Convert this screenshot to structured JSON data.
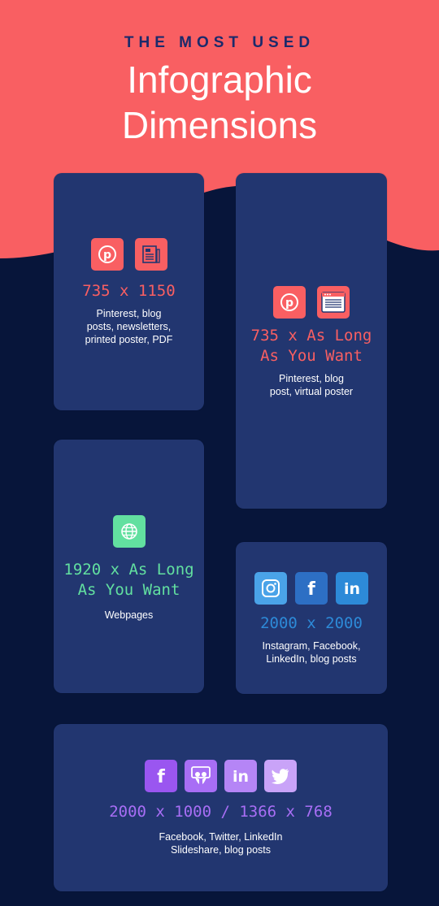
{
  "header": {
    "kicker": "THE MOST USED",
    "title_line1": "Infographic",
    "title_line2": "Dimensions"
  },
  "colors": {
    "background": "#07153a",
    "hero": "#f95f62",
    "card": "#223670",
    "pink": "#f95f62",
    "green": "#62e0a0",
    "blue": "#2d8ad8",
    "purple": "#a86ef5"
  },
  "cards": [
    {
      "dimensions": "735 x 1150",
      "description_lines": [
        "Pinterest, blog",
        "posts, newsletters,",
        "printed poster, PDF"
      ],
      "icons": [
        "pinterest-icon",
        "newsletter-icon"
      ]
    },
    {
      "dimensions_lines": [
        "735 x As Long",
        "As You Want"
      ],
      "description_lines": [
        "Pinterest, blog",
        "post, virtual poster"
      ],
      "icons": [
        "pinterest-icon",
        "browser-window-icon"
      ]
    },
    {
      "dimensions_lines": [
        "1920 x As Long",
        "As You Want"
      ],
      "description_lines": [
        "Webpages"
      ],
      "icons": [
        "globe-icon"
      ]
    },
    {
      "dimensions": "2000 x 2000",
      "description_lines": [
        "Instagram, Facebook,",
        "LinkedIn, blog posts"
      ],
      "icons": [
        "instagram-icon",
        "facebook-icon",
        "linkedin-icon"
      ]
    },
    {
      "dimensions": "2000 x 1000 / 1366 x 768",
      "description_lines": [
        "Facebook, Twitter, LinkedIn",
        "Slideshare, blog posts"
      ],
      "icons": [
        "facebook-icon",
        "slideshare-icon",
        "linkedin-icon",
        "twitter-icon"
      ]
    }
  ]
}
